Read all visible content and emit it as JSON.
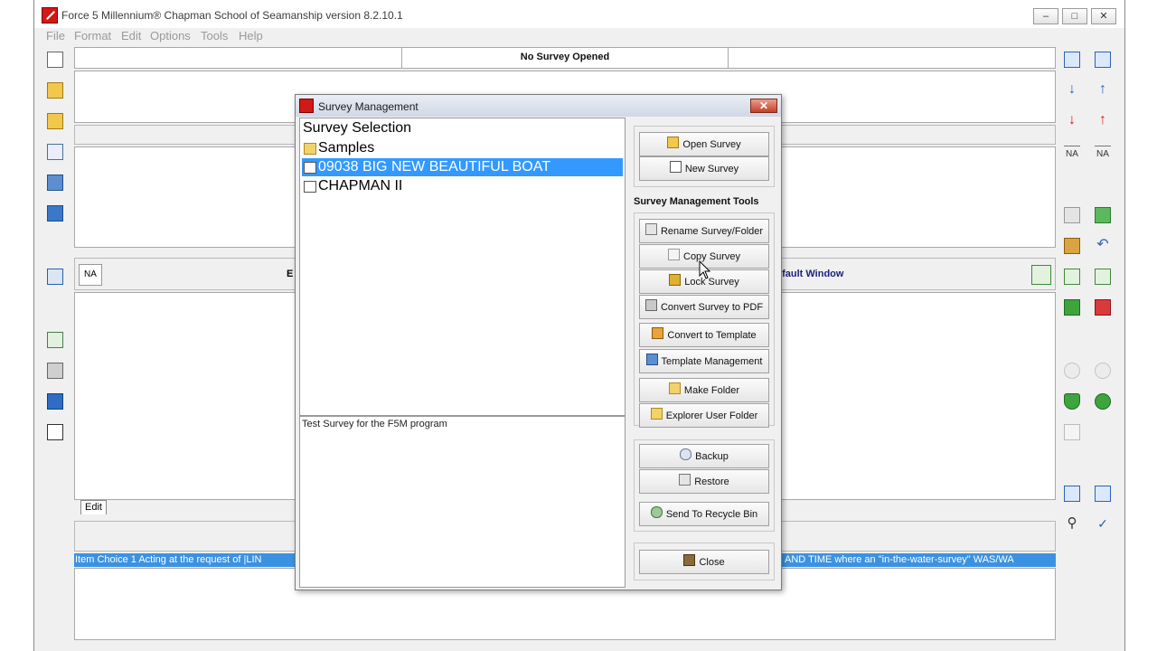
{
  "app": {
    "title": "Force 5 Millennium® Chapman School of Seamanship version 8.2.10.1"
  },
  "window_controls": {
    "minimize": "–",
    "maximize": "□",
    "close": "✕"
  },
  "menu": [
    "File",
    "Format",
    "Edit",
    "Options",
    "Tools",
    "Help"
  ],
  "header": {
    "status": "No Survey Opened"
  },
  "edit_bar": {
    "left_text": "E",
    "right_text": "efault Window",
    "na_label": "NA"
  },
  "edit_tab": "Edit",
  "item_choice": "Item Choice 1  Acting at the request of |LIN",
  "item_choice_right": "AND TIME where an \"in-the-water-survey\" WAS/WA",
  "left_toolbar_icons": [
    "new-document-icon",
    "open-folder-icon",
    "open-folder-2-icon",
    "edit-note-icon",
    "export-icon",
    "book-icon",
    "tree-view-icon",
    "list-icon",
    "printer-icon",
    "open-book-icon",
    "list-detail-icon"
  ],
  "right_toolbar": {
    "na_label": "NA"
  },
  "dialog": {
    "title": "Survey Management",
    "close_label": "✕",
    "list_title": "Survey Selection",
    "items": [
      {
        "label": "Samples",
        "icon": "folder-icon",
        "selected": false
      },
      {
        "label": "09038 BIG NEW BEAUTIFUL BOAT",
        "icon": "survey-doc-icon",
        "selected": true
      },
      {
        "label": "CHAPMAN II",
        "icon": "survey-doc-icon",
        "selected": false
      }
    ],
    "description": "Test Survey for the F5M program",
    "buttons": {
      "open": "Open Survey",
      "new": "New Survey",
      "tools_title": "Survey Management Tools",
      "rename": "Rename Survey/Folder",
      "copy": "Copy Survey",
      "lock": "Lock Survey",
      "pdf": "Convert Survey to PDF",
      "template": "Convert to Template",
      "template_mgmt": "Template Management",
      "make_folder": "Make Folder",
      "explorer": "Explorer User Folder",
      "backup": "Backup",
      "restore": "Restore",
      "recycle": "Send To Recycle Bin",
      "close": "Close"
    }
  },
  "colors": {
    "selection": "#3399ff",
    "item_choice_bg": "#3b92e3",
    "app_icon": "#d31818"
  }
}
